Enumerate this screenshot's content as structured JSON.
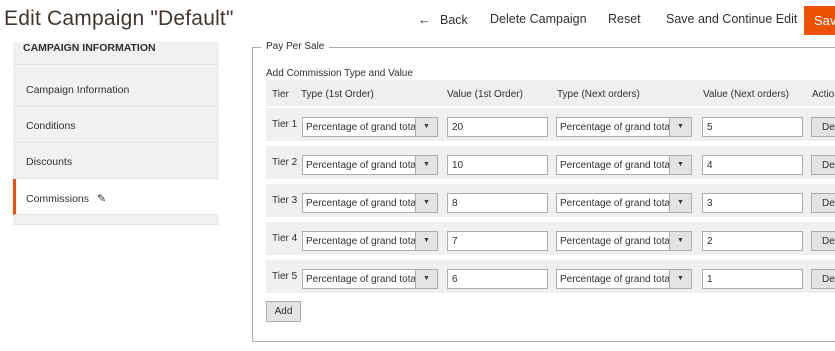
{
  "header": {
    "title": "Edit Campaign \"Default\"",
    "back_label": "Back",
    "delete_label": "Delete Campaign",
    "reset_label": "Reset",
    "save_continue_label": "Save and Continue Edit",
    "save_label": "Save"
  },
  "sidebar": {
    "title": "CAMPAIGN INFORMATION",
    "items": [
      {
        "label": "Campaign Information"
      },
      {
        "label": "Conditions"
      },
      {
        "label": "Discounts"
      },
      {
        "label": "Commissions",
        "active": true
      }
    ]
  },
  "fieldset": {
    "legend": "Pay Per Sale",
    "section_label": "Add Commission Type and Value",
    "columns": [
      "Tier",
      "Type (1st Order)",
      "Value (1st Order)",
      "Type (Next orders)",
      "Value (Next orders)",
      "Action"
    ],
    "rows": [
      {
        "tier": "Tier 1",
        "type_first": "Percentage of grand total",
        "value_first": "20",
        "type_next": "Percentage of grand total",
        "value_next": "5",
        "action": "Delete"
      },
      {
        "tier": "Tier 2",
        "type_first": "Percentage of grand total",
        "value_first": "10",
        "type_next": "Percentage of grand total",
        "value_next": "4",
        "action": "Delete"
      },
      {
        "tier": "Tier 3",
        "type_first": "Percentage of grand total",
        "value_first": "8",
        "type_next": "Percentage of grand total",
        "value_next": "3",
        "action": "Delete"
      },
      {
        "tier": "Tier 4",
        "type_first": "Percentage of grand total",
        "value_first": "7",
        "type_next": "Percentage of grand total",
        "value_next": "2",
        "action": "Delete"
      },
      {
        "tier": "Tier 5",
        "type_first": "Percentage of grand total",
        "value_first": "6",
        "type_next": "Percentage of grand total",
        "value_next": "1",
        "action": "Delete"
      }
    ],
    "add_label": "Add"
  },
  "icons": {
    "back": "arrow-left-icon",
    "edit": "pencil-icon",
    "select": "caret-down-icon"
  },
  "colors": {
    "accent": "#eb5202",
    "text": "#303030",
    "row_bg": "#f0f0f0",
    "sidebar_bg": "#f1f1f1"
  }
}
